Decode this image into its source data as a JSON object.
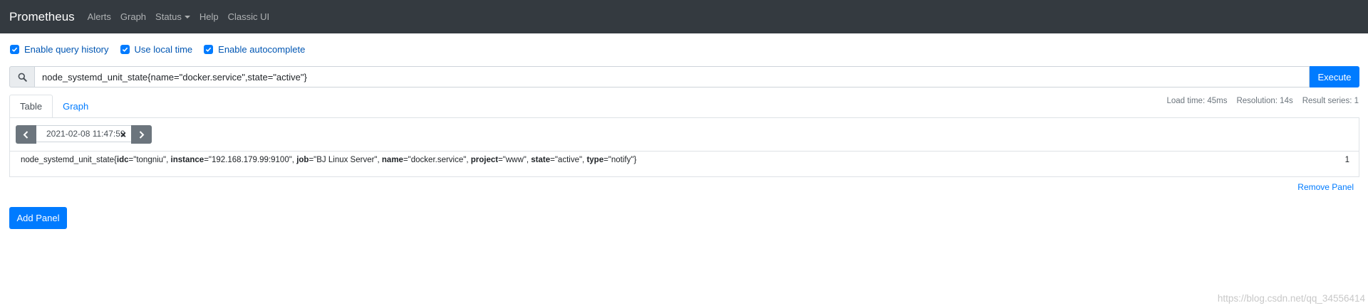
{
  "navbar": {
    "brand": "Prometheus",
    "items": [
      "Alerts",
      "Graph",
      "Status",
      "Help",
      "Classic UI"
    ]
  },
  "options": {
    "query_history": "Enable query history",
    "local_time": "Use local time",
    "autocomplete": "Enable autocomplete"
  },
  "query": {
    "value": "node_systemd_unit_state{name=\"docker.service\",state=\"active\"}",
    "execute_label": "Execute"
  },
  "tabs": {
    "table": "Table",
    "graph": "Graph"
  },
  "stats": {
    "load_time": "Load time: 45ms",
    "resolution": "Resolution: 14s",
    "result_series": "Result series: 1"
  },
  "time": {
    "value": "2021-02-08 11:47:59",
    "clear": "×"
  },
  "result": {
    "metric": "node_systemd_unit_state{",
    "labels": [
      {
        "key": "idc",
        "value": "=\"tongniu\", "
      },
      {
        "key": "instance",
        "value": "=\"192.168.179.99:9100\", "
      },
      {
        "key": "job",
        "value": "=\"BJ Linux Server\", "
      },
      {
        "key": "name",
        "value": "=\"docker.service\", "
      },
      {
        "key": "project",
        "value": "=\"www\", "
      },
      {
        "key": "state",
        "value": "=\"active\", "
      },
      {
        "key": "type",
        "value": "=\"notify\""
      }
    ],
    "close": "}",
    "value": "1"
  },
  "actions": {
    "remove_panel": "Remove Panel",
    "add_panel": "Add Panel"
  },
  "watermark": "https://blog.csdn.net/qq_34556414",
  "colors": {
    "navbar": "#343a40",
    "primary": "#007bff",
    "secondary": "#6c757d"
  }
}
